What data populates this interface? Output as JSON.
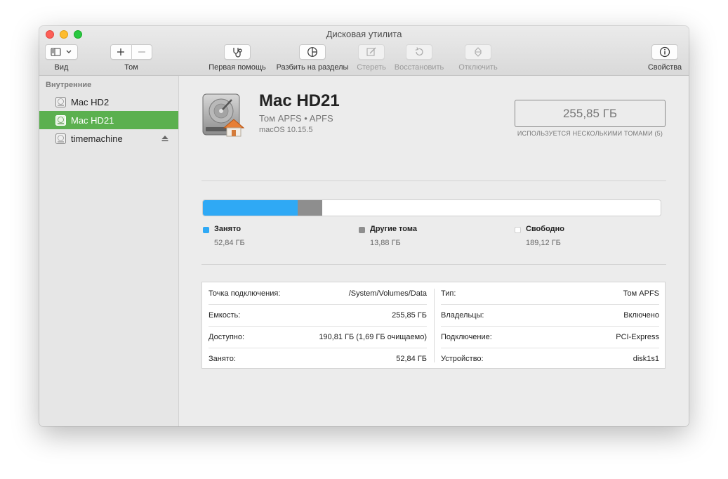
{
  "window": {
    "title": "Дисковая утилита"
  },
  "toolbar": {
    "view_label": "Вид",
    "volume_label": "Том",
    "first_aid_label": "Первая помощь",
    "partition_label": "Разбить на разделы",
    "erase_label": "Стереть",
    "restore_label": "Восстановить",
    "unmount_label": "Отключить",
    "info_label": "Свойства"
  },
  "sidebar": {
    "section_title": "Внутренние",
    "items": [
      {
        "label": "Mac HD2",
        "selected": false,
        "ejectable": false
      },
      {
        "label": "Mac HD21",
        "selected": true,
        "ejectable": false
      },
      {
        "label": "timemachine",
        "selected": false,
        "ejectable": true
      }
    ]
  },
  "volume": {
    "name": "Mac HD21",
    "subtitle": "Том APFS • APFS",
    "os": "macOS 10.15.5",
    "size": "255,85 ГБ",
    "size_note": "ИСПОЛЬЗУЕТСЯ НЕСКОЛЬКИМИ ТОМАМИ (5)"
  },
  "usage": {
    "total_gb": 255.85,
    "segments": [
      {
        "name": "Занято",
        "value": "52,84 ГБ",
        "gb": 52.84,
        "color": "#2fa9f5"
      },
      {
        "name": "Другие тома",
        "value": "13,88 ГБ",
        "gb": 13.88,
        "color": "#8e8e8e"
      },
      {
        "name": "Свободно",
        "value": "189,12 ГБ",
        "gb": 189.12,
        "color": "#ffffff"
      }
    ]
  },
  "info": {
    "left": [
      {
        "label": "Точка подключения:",
        "value": "/System/Volumes/Data"
      },
      {
        "label": "Емкость:",
        "value": "255,85 ГБ"
      },
      {
        "label": "Доступно:",
        "value": "190,81 ГБ (1,69 ГБ очищаемо)"
      },
      {
        "label": "Занято:",
        "value": "52,84 ГБ"
      }
    ],
    "right": [
      {
        "label": "Тип:",
        "value": "Том APFS"
      },
      {
        "label": "Владельцы:",
        "value": "Включено"
      },
      {
        "label": "Подключение:",
        "value": "PCI-Express"
      },
      {
        "label": "Устройство:",
        "value": "disk1s1"
      }
    ]
  },
  "colors": {
    "selection": "#5bb04f",
    "used": "#2fa9f5",
    "other": "#8e8e8e"
  }
}
